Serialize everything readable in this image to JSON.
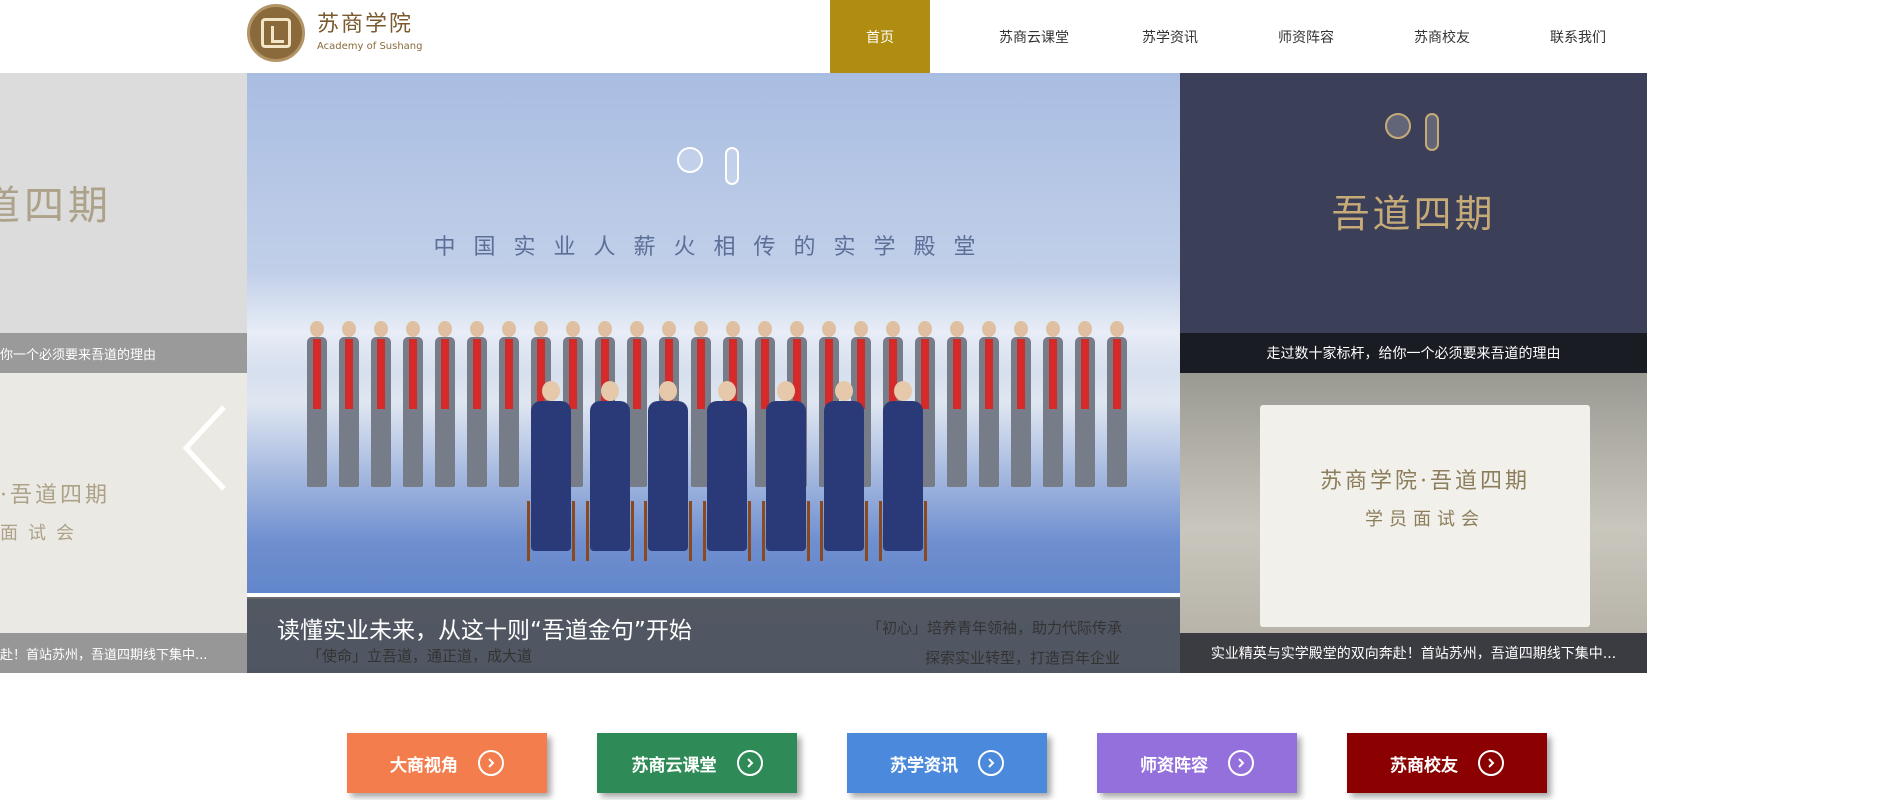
{
  "header": {
    "logo_cn": "苏商学院",
    "logo_en": "Academy of Sushang",
    "nav": [
      {
        "label": "首页",
        "active": true
      },
      {
        "label": "苏商云课堂",
        "active": false
      },
      {
        "label": "苏学资讯",
        "active": false
      },
      {
        "label": "师资阵容",
        "active": false
      },
      {
        "label": "苏商校友",
        "active": false
      },
      {
        "label": "联系我们",
        "active": false
      }
    ]
  },
  "carousel": {
    "left": {
      "title": "道四期",
      "band": "你一个必须要来吾道的理由",
      "board_title": "·吾道四期",
      "board_sub": "面试会",
      "caption": "赴！首站苏州，吾道四期线下集中..."
    },
    "center": {
      "slogan": "中国实业人薪火相传的实学殿堂",
      "caption_title": "读懂实业未来，从这十则“吾道金句”开始",
      "caption_line1": "「初心」培养青年领袖，助力代际传承",
      "caption_line2": "「使命」立吾道，通正道，成大道",
      "caption_line3": "探索实业转型，打造百年企业"
    },
    "right": {
      "title": "吾道四期",
      "band": "走过数十家标杆，给你一个必须要来吾道的理由",
      "board_title": "苏商学院·吾道四期",
      "board_sub": "学员面试会",
      "caption": "实业精英与实学殿堂的双向奔赴！首站苏州，吾道四期线下集中..."
    }
  },
  "quick_links": [
    {
      "label": "大商视角",
      "color": "#f47d4e"
    },
    {
      "label": "苏商云课堂",
      "color": "#2e8b57"
    },
    {
      "label": "苏学资讯",
      "color": "#4a89dc"
    },
    {
      "label": "师资阵容",
      "color": "#9370db"
    },
    {
      "label": "苏商校友",
      "color": "#8b0000"
    }
  ]
}
